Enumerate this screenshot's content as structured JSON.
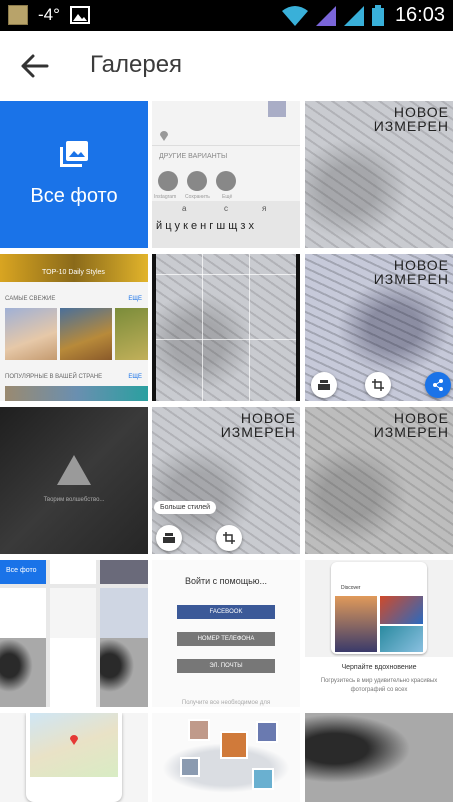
{
  "status_bar": {
    "temperature": "-4°",
    "time": "16:03",
    "icons": [
      "notes-icon",
      "image-icon",
      "wifi-icon",
      "signal-icon",
      "signal-icon",
      "battery-icon"
    ]
  },
  "app_bar": {
    "title": "Галерея",
    "back_icon": "arrow-back-icon"
  },
  "tiles": {
    "all_photos": {
      "label": "Все фото",
      "icon": "photo-library-icon"
    },
    "share_screen": {
      "section": "ДРУГИЕ ВАРИАНТЫ",
      "options": [
        "Instagram",
        "Сохранить",
        "Ещё"
      ],
      "suggest": [
        "а",
        "с",
        "я"
      ],
      "keyboard_row": "й ц у к е н г ш щ з х"
    },
    "feed": {
      "banner": "TOP-10 Daily Styles",
      "fresh": "САМЫЕ СВЕЖИЕ",
      "fresh_more": "ЕЩЕ",
      "popular": "ПОПУЛЯРНЫЕ В ВАШЕЙ СТРАНЕ",
      "popular_more": "ЕЩЕ"
    },
    "overlay_text": [
      "НОВОЕ",
      "ИЗМЕРЕН"
    ],
    "loading_text": "Творим волшебство...",
    "more_styles": "Больше стилей",
    "mini_all_photos": "Все фото",
    "login": {
      "title": "Войти с помощью...",
      "facebook": "FACEBOOK",
      "phone": "НОМЕР ТЕЛЕФОНА",
      "email": "ЭЛ. ПОЧТЫ",
      "footer": "Получите все необходимое для"
    },
    "discover": {
      "header": "Discover",
      "title": "Черпайте вдохновение",
      "subtitle": "Погрузитесь в мир удивительно красивых фотографий со всех"
    }
  }
}
